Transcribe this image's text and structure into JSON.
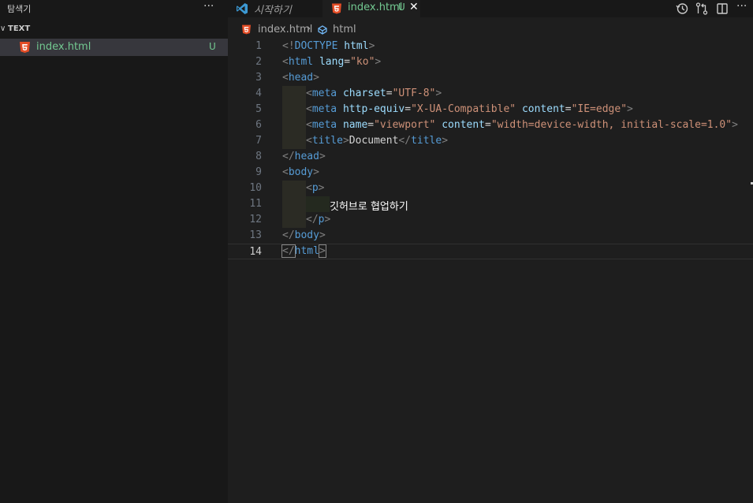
{
  "sidebar": {
    "title": "탐색기",
    "more": "···",
    "folder": {
      "chevron": "∨",
      "name": "TEXT"
    },
    "files": [
      {
        "name": "index.html",
        "badge": "U",
        "icon": "html5-icon"
      }
    ]
  },
  "tabs": {
    "welcome": {
      "label": "시작하기",
      "icon": "vscode-icon"
    },
    "index": {
      "label": "index.html",
      "badge": "U",
      "close": "✕",
      "icon": "html5-icon"
    }
  },
  "editor_actions": [
    "timeline-icon",
    "compare-changes-icon",
    "split-editor-icon",
    "more-actions-icon"
  ],
  "editor_actions_more": "···",
  "breadcrumb": {
    "file": "index.html",
    "separator": "›",
    "element": "html"
  },
  "code": {
    "active_line": 14,
    "lines": [
      {
        "n": "1"
      },
      {
        "n": "2"
      },
      {
        "n": "3"
      },
      {
        "n": "4"
      },
      {
        "n": "5"
      },
      {
        "n": "6"
      },
      {
        "n": "7"
      },
      {
        "n": "8"
      },
      {
        "n": "9"
      },
      {
        "n": "10"
      },
      {
        "n": "11"
      },
      {
        "n": "12"
      },
      {
        "n": "13"
      },
      {
        "n": "14"
      }
    ],
    "tokens": {
      "l1": [
        "<!",
        "DOCTYPE",
        " html",
        ">"
      ],
      "l2": [
        "<",
        "html",
        " lang",
        "=",
        "\"ko\"",
        ">"
      ],
      "l3": [
        "<",
        "head",
        ">"
      ],
      "l4": [
        "<",
        "meta",
        " charset",
        "=",
        "\"UTF-8\"",
        ">"
      ],
      "l5": [
        "<",
        "meta",
        " http-equiv",
        "=",
        "\"X-UA-Compatible\"",
        " content",
        "=",
        "\"IE=edge\"",
        ">"
      ],
      "l6": [
        "<",
        "meta",
        " name",
        "=",
        "\"viewport\"",
        " content",
        "=",
        "\"width=device-width, initial-scale=1.0\"",
        ">"
      ],
      "l7": [
        "<",
        "title",
        ">",
        "Document",
        "</",
        "title",
        ">"
      ],
      "l8": [
        "</",
        "head",
        ">"
      ],
      "l9": [
        "<",
        "body",
        ">"
      ],
      "l10": [
        "<",
        "p",
        ">"
      ],
      "l11": [
        "깃허브로 협업하기"
      ],
      "l12": [
        "</",
        "p",
        ">"
      ],
      "l13": [
        "</",
        "body",
        ">"
      ],
      "l14": [
        "</",
        "html",
        ">"
      ]
    }
  },
  "colors": {
    "tag_bracket": "#808080",
    "tag_name": "#569cd6",
    "attribute": "#9cdcfe",
    "string": "#ce9178",
    "untracked": "#73c991",
    "html5": "#e44d26"
  }
}
